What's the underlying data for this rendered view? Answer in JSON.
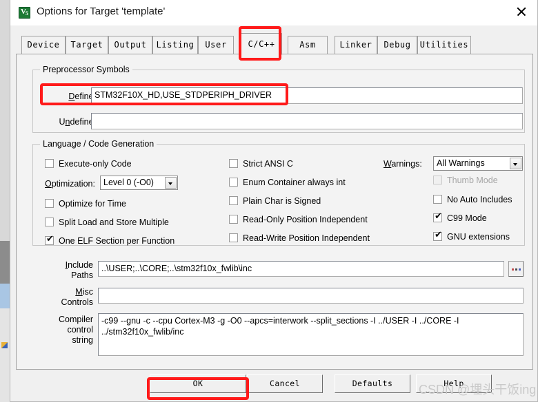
{
  "window": {
    "title": "Options for Target 'template'",
    "icon": "keil-uvision5-icon",
    "icon_letter": "V",
    "icon_version": "5",
    "close_label": "✕"
  },
  "tabs": [
    {
      "label": "Device",
      "active": false
    },
    {
      "label": "Target",
      "active": false
    },
    {
      "label": "Output",
      "active": false
    },
    {
      "label": "Listing",
      "active": false
    },
    {
      "label": "User",
      "active": false
    },
    {
      "label": "C/C++",
      "active": true
    },
    {
      "label": "Asm",
      "active": false
    },
    {
      "label": "Linker",
      "active": false
    },
    {
      "label": "Debug",
      "active": false
    },
    {
      "label": "Utilities",
      "active": false
    }
  ],
  "preprocessor": {
    "group_title": "Preprocessor Symbols",
    "define_label": "Define:",
    "define_value": "STM32F10X_HD,USE_STDPERIPH_DRIVER",
    "undefine_label": "Undefine:",
    "undefine_value": ""
  },
  "language": {
    "group_title": "Language / Code Generation",
    "left_checks": [
      {
        "label": "Execute-only Code",
        "checked": false,
        "disabled": false
      },
      {
        "label": "Optimize for Time",
        "checked": false,
        "disabled": false
      },
      {
        "label": "Split Load and Store Multiple",
        "checked": false,
        "disabled": false
      },
      {
        "label": "One ELF Section per Function",
        "checked": true,
        "disabled": false
      }
    ],
    "optimization_label": "Optimization:",
    "optimization_value": "Level 0 (-O0)",
    "middle_checks": [
      {
        "label": "Strict ANSI C",
        "checked": false,
        "disabled": false
      },
      {
        "label": "Enum Container always int",
        "checked": false,
        "disabled": false
      },
      {
        "label": "Plain Char is Signed",
        "checked": false,
        "disabled": false
      },
      {
        "label": "Read-Only Position Independent",
        "checked": false,
        "disabled": false
      },
      {
        "label": "Read-Write Position Independent",
        "checked": false,
        "disabled": false
      }
    ],
    "warnings_label": "Warnings:",
    "warnings_value": "All Warnings",
    "right_checks": [
      {
        "label": "Thumb Mode",
        "checked": false,
        "disabled": true
      },
      {
        "label": "No Auto Includes",
        "checked": false,
        "disabled": false
      },
      {
        "label": "C99 Mode",
        "checked": true,
        "disabled": false
      },
      {
        "label": "GNU extensions",
        "checked": true,
        "disabled": false
      }
    ],
    "check_mark": "✔"
  },
  "paths": {
    "include_label_line1": "Include",
    "include_label_line2": "Paths",
    "include_value": "..\\USER;..\\CORE;..\\stm32f10x_fwlib\\inc",
    "browse_label": "...",
    "misc_label_line1": "Misc",
    "misc_label_line2": "Controls",
    "misc_value": "",
    "compiler_label_line1": "Compiler",
    "compiler_label_line2": "control",
    "compiler_label_line3": "string",
    "compiler_value": "-c99 --gnu -c --cpu Cortex-M3 -g -O0 --apcs=interwork --split_sections -I ../USER -I ../CORE -I ../stm32f10x_fwlib/inc"
  },
  "buttons": {
    "ok": "OK",
    "cancel": "Cancel",
    "defaults": "Defaults",
    "help": "Help"
  },
  "watermark": "CSDN @埋头干饭ing",
  "annotations": {
    "color": "#ff1a1a",
    "boxes": [
      "c-cpp-tab",
      "define-field",
      "ok-button"
    ]
  }
}
